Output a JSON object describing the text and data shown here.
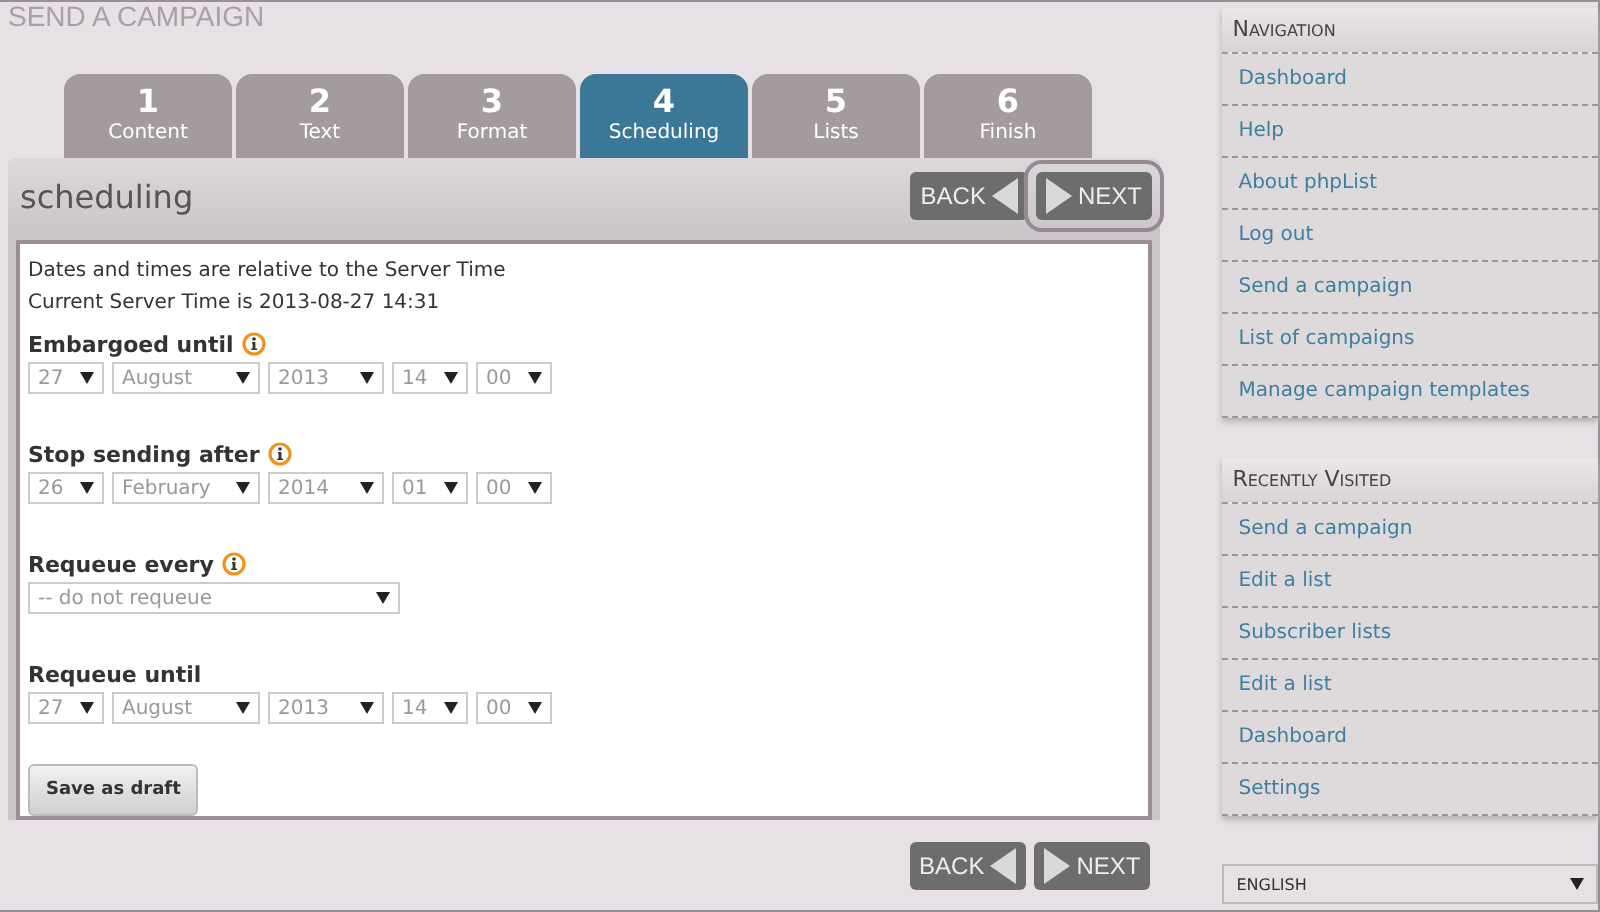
{
  "page_title": "SEND A CAMPAIGN",
  "tabs": [
    {
      "number": "1",
      "label": "Content",
      "selected": false
    },
    {
      "number": "2",
      "label": "Text",
      "selected": false
    },
    {
      "number": "3",
      "label": "Format",
      "selected": false
    },
    {
      "number": "4",
      "label": "Scheduling",
      "selected": true
    },
    {
      "number": "5",
      "label": "Lists",
      "selected": false
    },
    {
      "number": "6",
      "label": "Finish",
      "selected": false
    }
  ],
  "panel": {
    "title": "scheduling",
    "top_nav": [
      {
        "kind": "back",
        "label": "BACK",
        "focused": false
      },
      {
        "kind": "next",
        "label": "NEXT",
        "focused": true
      }
    ],
    "intro": [
      "Dates and times are relative to the Server Time",
      "Current Server Time is 2013-08-27 14:31"
    ],
    "sections": [
      {
        "label": "Embargoed until",
        "info": true,
        "kind": "date",
        "fields": [
          "27",
          "August",
          "2013",
          "14",
          "00"
        ]
      },
      {
        "label": "Stop sending after",
        "info": true,
        "kind": "date",
        "fields": [
          "26",
          "February",
          "2014",
          "01",
          "00"
        ]
      },
      {
        "label": "Requeue every",
        "info": true,
        "kind": "single",
        "fields": [
          "-- do not requeue"
        ]
      },
      {
        "label": "Requeue until",
        "info": false,
        "kind": "date",
        "fields": [
          "27",
          "August",
          "2013",
          "14",
          "00"
        ]
      }
    ],
    "save_button": "Save as draft",
    "bottom_nav": [
      {
        "kind": "back",
        "label": "BACK",
        "focused": false
      },
      {
        "kind": "next",
        "label": "NEXT",
        "focused": false
      }
    ]
  },
  "sidebar": [
    {
      "title": "Navigation",
      "items": [
        "Dashboard",
        "Help",
        "About phpList",
        "Log out",
        "Send a campaign",
        "List of campaigns",
        "Manage campaign templates"
      ]
    },
    {
      "title": "Recently Visited",
      "items": [
        "Send a campaign",
        "Edit a list",
        "Subscriber lists",
        "Edit a list",
        "Dashboard",
        "Settings"
      ]
    }
  ],
  "language": "ENGLISH"
}
